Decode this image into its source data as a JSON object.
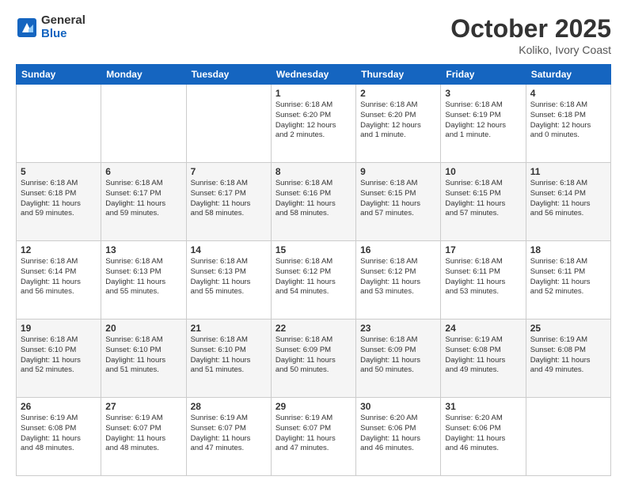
{
  "logo": {
    "general": "General",
    "blue": "Blue"
  },
  "title": "October 2025",
  "subtitle": "Koliko, Ivory Coast",
  "days_of_week": [
    "Sunday",
    "Monday",
    "Tuesday",
    "Wednesday",
    "Thursday",
    "Friday",
    "Saturday"
  ],
  "weeks": [
    [
      {
        "day": "",
        "info": ""
      },
      {
        "day": "",
        "info": ""
      },
      {
        "day": "",
        "info": ""
      },
      {
        "day": "1",
        "info": "Sunrise: 6:18 AM\nSunset: 6:20 PM\nDaylight: 12 hours\nand 2 minutes."
      },
      {
        "day": "2",
        "info": "Sunrise: 6:18 AM\nSunset: 6:20 PM\nDaylight: 12 hours\nand 1 minute."
      },
      {
        "day": "3",
        "info": "Sunrise: 6:18 AM\nSunset: 6:19 PM\nDaylight: 12 hours\nand 1 minute."
      },
      {
        "day": "4",
        "info": "Sunrise: 6:18 AM\nSunset: 6:18 PM\nDaylight: 12 hours\nand 0 minutes."
      }
    ],
    [
      {
        "day": "5",
        "info": "Sunrise: 6:18 AM\nSunset: 6:18 PM\nDaylight: 11 hours\nand 59 minutes."
      },
      {
        "day": "6",
        "info": "Sunrise: 6:18 AM\nSunset: 6:17 PM\nDaylight: 11 hours\nand 59 minutes."
      },
      {
        "day": "7",
        "info": "Sunrise: 6:18 AM\nSunset: 6:17 PM\nDaylight: 11 hours\nand 58 minutes."
      },
      {
        "day": "8",
        "info": "Sunrise: 6:18 AM\nSunset: 6:16 PM\nDaylight: 11 hours\nand 58 minutes."
      },
      {
        "day": "9",
        "info": "Sunrise: 6:18 AM\nSunset: 6:15 PM\nDaylight: 11 hours\nand 57 minutes."
      },
      {
        "day": "10",
        "info": "Sunrise: 6:18 AM\nSunset: 6:15 PM\nDaylight: 11 hours\nand 57 minutes."
      },
      {
        "day": "11",
        "info": "Sunrise: 6:18 AM\nSunset: 6:14 PM\nDaylight: 11 hours\nand 56 minutes."
      }
    ],
    [
      {
        "day": "12",
        "info": "Sunrise: 6:18 AM\nSunset: 6:14 PM\nDaylight: 11 hours\nand 56 minutes."
      },
      {
        "day": "13",
        "info": "Sunrise: 6:18 AM\nSunset: 6:13 PM\nDaylight: 11 hours\nand 55 minutes."
      },
      {
        "day": "14",
        "info": "Sunrise: 6:18 AM\nSunset: 6:13 PM\nDaylight: 11 hours\nand 55 minutes."
      },
      {
        "day": "15",
        "info": "Sunrise: 6:18 AM\nSunset: 6:12 PM\nDaylight: 11 hours\nand 54 minutes."
      },
      {
        "day": "16",
        "info": "Sunrise: 6:18 AM\nSunset: 6:12 PM\nDaylight: 11 hours\nand 53 minutes."
      },
      {
        "day": "17",
        "info": "Sunrise: 6:18 AM\nSunset: 6:11 PM\nDaylight: 11 hours\nand 53 minutes."
      },
      {
        "day": "18",
        "info": "Sunrise: 6:18 AM\nSunset: 6:11 PM\nDaylight: 11 hours\nand 52 minutes."
      }
    ],
    [
      {
        "day": "19",
        "info": "Sunrise: 6:18 AM\nSunset: 6:10 PM\nDaylight: 11 hours\nand 52 minutes."
      },
      {
        "day": "20",
        "info": "Sunrise: 6:18 AM\nSunset: 6:10 PM\nDaylight: 11 hours\nand 51 minutes."
      },
      {
        "day": "21",
        "info": "Sunrise: 6:18 AM\nSunset: 6:10 PM\nDaylight: 11 hours\nand 51 minutes."
      },
      {
        "day": "22",
        "info": "Sunrise: 6:18 AM\nSunset: 6:09 PM\nDaylight: 11 hours\nand 50 minutes."
      },
      {
        "day": "23",
        "info": "Sunrise: 6:18 AM\nSunset: 6:09 PM\nDaylight: 11 hours\nand 50 minutes."
      },
      {
        "day": "24",
        "info": "Sunrise: 6:19 AM\nSunset: 6:08 PM\nDaylight: 11 hours\nand 49 minutes."
      },
      {
        "day": "25",
        "info": "Sunrise: 6:19 AM\nSunset: 6:08 PM\nDaylight: 11 hours\nand 49 minutes."
      }
    ],
    [
      {
        "day": "26",
        "info": "Sunrise: 6:19 AM\nSunset: 6:08 PM\nDaylight: 11 hours\nand 48 minutes."
      },
      {
        "day": "27",
        "info": "Sunrise: 6:19 AM\nSunset: 6:07 PM\nDaylight: 11 hours\nand 48 minutes."
      },
      {
        "day": "28",
        "info": "Sunrise: 6:19 AM\nSunset: 6:07 PM\nDaylight: 11 hours\nand 47 minutes."
      },
      {
        "day": "29",
        "info": "Sunrise: 6:19 AM\nSunset: 6:07 PM\nDaylight: 11 hours\nand 47 minutes."
      },
      {
        "day": "30",
        "info": "Sunrise: 6:20 AM\nSunset: 6:06 PM\nDaylight: 11 hours\nand 46 minutes."
      },
      {
        "day": "31",
        "info": "Sunrise: 6:20 AM\nSunset: 6:06 PM\nDaylight: 11 hours\nand 46 minutes."
      },
      {
        "day": "",
        "info": ""
      }
    ]
  ]
}
